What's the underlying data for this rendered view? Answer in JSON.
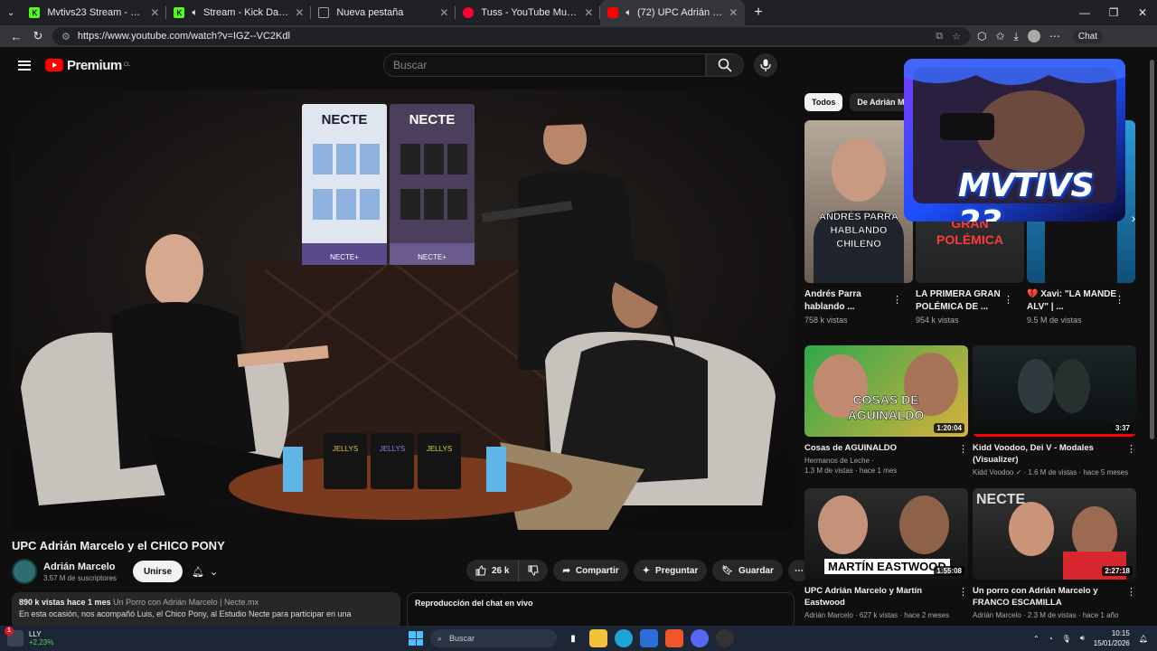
{
  "browser": {
    "tabs": [
      {
        "title": "Mvtivs23 Stream - Watch Live on ...",
        "color": "#53fc18"
      },
      {
        "title": "Stream - Kick Dashboard",
        "color": "#53fc18"
      },
      {
        "title": "Nueva pestaña",
        "color": "#9aa0a6"
      },
      {
        "title": "Tuss - YouTube Music",
        "color": "#ff0033"
      },
      {
        "title": "(72) UPC Adrián Marcelo y el ...",
        "color": "#ff0000"
      }
    ],
    "url": "https://www.youtube.com/watch?v=IGZ--VC2Kdl",
    "chat_label": "Chat"
  },
  "header": {
    "logo_text": "Premium",
    "logo_sup": "CL",
    "search_placeholder": "Buscar"
  },
  "video": {
    "title": "UPC Adrián Marcelo y el CHICO PONY",
    "channel": "Adrián Marcelo",
    "subscribers": "3.57 M de suscriptores",
    "join_label": "Unirse",
    "likes": "26 k",
    "share_label": "Compartir",
    "ask_label": "Preguntar",
    "save_label": "Guardar",
    "views_date": "890 k vistas  hace 1 mes",
    "desc_link": "Un Porro con Adrián Marcelo | Necte.mx",
    "description": "En esta ocasión, nos acompañó Luis, el Chico Pony, al Estudio Necte para participar en una",
    "chat_replay": "Reproducción del chat en vivo",
    "scene_text": {
      "brand": "NECTE",
      "brand_sub": "NECTE+",
      "jar1": "JELLYS",
      "jar2": "JELLYS",
      "jar3": "JELLYS"
    }
  },
  "chips": [
    "Todos",
    "De Adrián M"
  ],
  "shelf": [
    {
      "title": "Andrés Parra hablando ...",
      "views": "758 k vistas",
      "thumb_text": "ANDRÉS PARRA HABLANDO CHILENO"
    },
    {
      "title": "LA PRIMERA GRAN POLÉMICA DE ...",
      "views": "954 k vistas",
      "thumb_text": "GRAN POLÉMICA"
    },
    {
      "title": "💔 Xavi: \"LA MANDE ALV\" | ...",
      "views": "9.5 M de vistas",
      "thumb_text": ""
    }
  ],
  "stream_overlay": "MVTIVS 23",
  "recommended": [
    {
      "title": "Cosas de AGUINALDO",
      "channel": "Hermanos de Leche ·",
      "meta": "1.3 M de vistas · hace 1 mes",
      "duration": "1:20:04",
      "thumb_text": "COSAS DE AGUINALDO"
    },
    {
      "title": "Kidd Voodoo, Dei V - Modales (Visualizer)",
      "channel": "",
      "meta": "Kidd Voodoo ✓ · 1.6 M de vistas · hace 5 meses",
      "duration": "3:37",
      "thumb_text": ""
    },
    {
      "title": "UPC Adrián Marcelo y Martín Eastwood",
      "channel": "",
      "meta": "Adrián Marcelo · 627 k vistas · hace 2 meses",
      "duration": "1:55:08",
      "thumb_text": "MARTÍN EASTWOOD"
    },
    {
      "title": "Un porro con Adrián Marcelo y FRANCO ESCAMILLA",
      "channel": "",
      "meta": "Adrián Marcelo · 2.3 M de vistas · hace 1 año",
      "duration": "2:27:18",
      "thumb_text": "NECTE"
    }
  ],
  "taskbar": {
    "ticker": "LLY",
    "change": "+2,23%",
    "badge": "1",
    "search": "Buscar",
    "time": "10:15",
    "date": "15/01/2026"
  }
}
